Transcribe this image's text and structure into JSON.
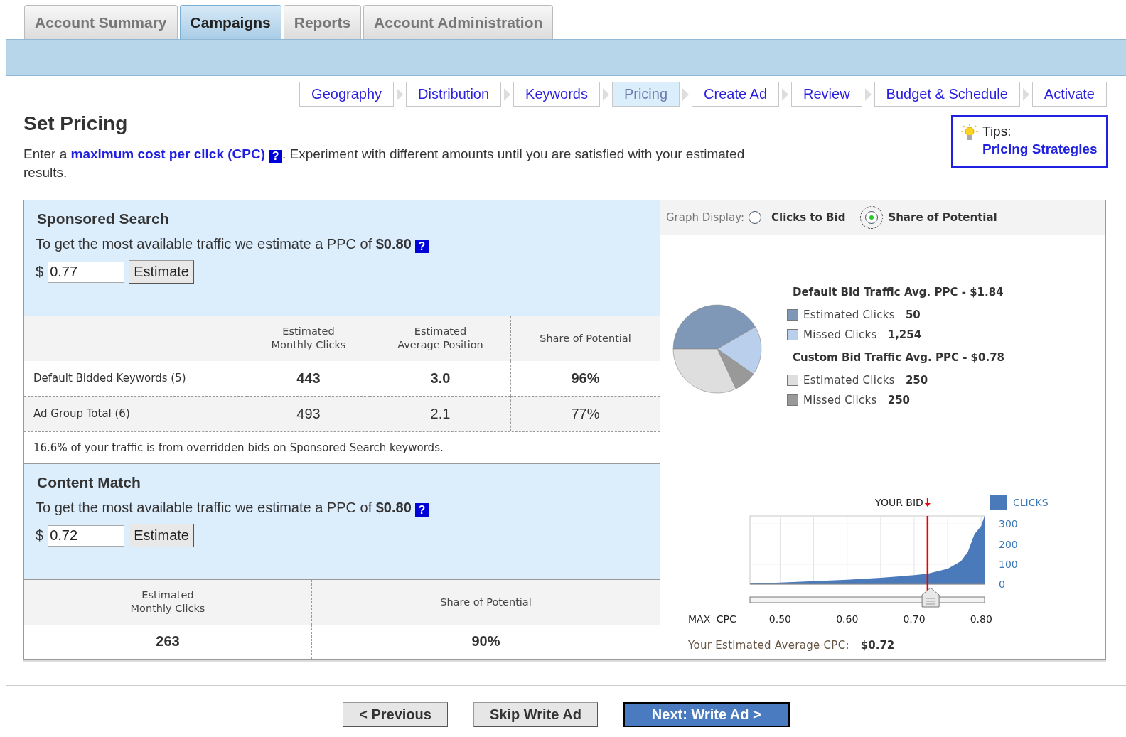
{
  "tabs": [
    {
      "label": "Account Summary",
      "selected": false
    },
    {
      "label": "Campaigns",
      "selected": true
    },
    {
      "label": "Reports",
      "selected": false
    },
    {
      "label": "Account Administration",
      "selected": false
    }
  ],
  "steps": [
    {
      "label": "Geography",
      "selected": false
    },
    {
      "label": "Distribution",
      "selected": false
    },
    {
      "label": "Keywords",
      "selected": false
    },
    {
      "label": "Pricing",
      "selected": true
    },
    {
      "label": "Create Ad",
      "selected": false
    },
    {
      "label": "Review",
      "selected": false
    },
    {
      "label": "Budget & Schedule",
      "selected": false
    },
    {
      "label": "Activate",
      "selected": false
    }
  ],
  "heading": {
    "title": "Set Pricing",
    "intro_before": "Enter a ",
    "intro_link": "maximum cost per click (CPC)",
    "help": "?",
    "intro_after": ". Experiment with different amounts until you are satisfied with your estimated results."
  },
  "tips": {
    "label": "Tips:",
    "link": "Pricing Strategies"
  },
  "sponsored_search": {
    "title": "Sponsored Search",
    "estimate_text": "To get the most available traffic we estimate a PPC of **$0.80**",
    "help": "?",
    "currency": "$",
    "bid_value": "0.77",
    "button": "Estimate",
    "table": {
      "columns": [
        "Estimated\nMonthly Clicks",
        "Estimated\nAverage Position",
        "Share of Potential"
      ],
      "rows": [
        {
          "label": "Default Bidded Keywords (5)",
          "emphasized": true,
          "cells": [
            "443",
            "3.0",
            "96%"
          ]
        },
        {
          "label": "Ad Group Total (6)",
          "emphasized": false,
          "cells": [
            "493",
            "2.1",
            "77%"
          ]
        }
      ]
    },
    "note": "16.6% of your traffic is from overridden bids on Sponsored Search keywords."
  },
  "graph_display": {
    "label": "Graph Display:",
    "options": [
      {
        "label": "Clicks to Bid",
        "selected": false
      },
      {
        "label": "Share of Potential",
        "selected": true
      }
    ]
  },
  "pie_legend": [
    {
      "title": "Default Bid Traffic Avg. PPC - $1.84",
      "items": [
        {
          "label": "Estimated Clicks",
          "value": "50",
          "color": "#7f98b8"
        },
        {
          "label": "Missed Clicks",
          "value": "1,254",
          "color": "#b9cfec"
        }
      ]
    },
    {
      "title": "Custom Bid Traffic Avg. PPC - $0.78",
      "items": [
        {
          "label": "Estimated Clicks",
          "value": "250",
          "color": "#dedede"
        },
        {
          "label": "Missed Clicks",
          "value": "250",
          "color": "#999999"
        }
      ]
    }
  ],
  "content_match": {
    "title": "Content Match",
    "estimate_text": "To get the most available traffic we estimate a PPC of **$0.80**",
    "help": "?",
    "currency": "$",
    "bid_value": "0.72",
    "button": "Estimate",
    "table": {
      "columns": [
        "Estimated\nMonthly Clicks",
        "Share of Potential"
      ],
      "rows": [
        {
          "emphasized": true,
          "cells": [
            "263",
            "90%"
          ]
        }
      ]
    }
  },
  "bid_chart": {
    "slider": {
      "level": 0.77
    },
    "chart_data": {
      "type": "area",
      "xlabel": "MAX CPC",
      "x": [
        0.455,
        0.5,
        0.55,
        0.6,
        0.65,
        0.7,
        0.72,
        0.75,
        0.77,
        0.78,
        0.79,
        0.8,
        0.805
      ],
      "series": [
        {
          "name": "CLICKS",
          "color": "#4a7aba",
          "values": [
            3,
            8,
            15,
            22,
            32,
            45,
            52,
            77,
            115,
            160,
            250,
            290,
            340
          ]
        }
      ],
      "xlim": [
        0.455,
        0.805
      ],
      "ylim": [
        0,
        340
      ],
      "grid": true,
      "xticks": [
        {
          "value": 0.5,
          "label": "0.50"
        },
        {
          "value": 0.6,
          "label": "0.60"
        },
        {
          "value": 0.7,
          "label": "0.70"
        },
        {
          "value": 0.8,
          "label": "0.80"
        }
      ],
      "yticks": [
        0,
        100,
        200,
        300
      ],
      "ref_lines": [
        {
          "axis": "x",
          "value": 0.72,
          "label": "YOUR BID",
          "color": "#ee0000"
        }
      ]
    },
    "average_cpc_label": "Your Estimated Average CPC:",
    "average_cpc_value": "$0.72"
  },
  "buttons": [
    {
      "label": "< Previous",
      "kind": "secondary"
    },
    {
      "label": "Skip Write Ad",
      "kind": "secondary"
    },
    {
      "label": "Next: Write Ad >",
      "kind": "primary"
    }
  ]
}
